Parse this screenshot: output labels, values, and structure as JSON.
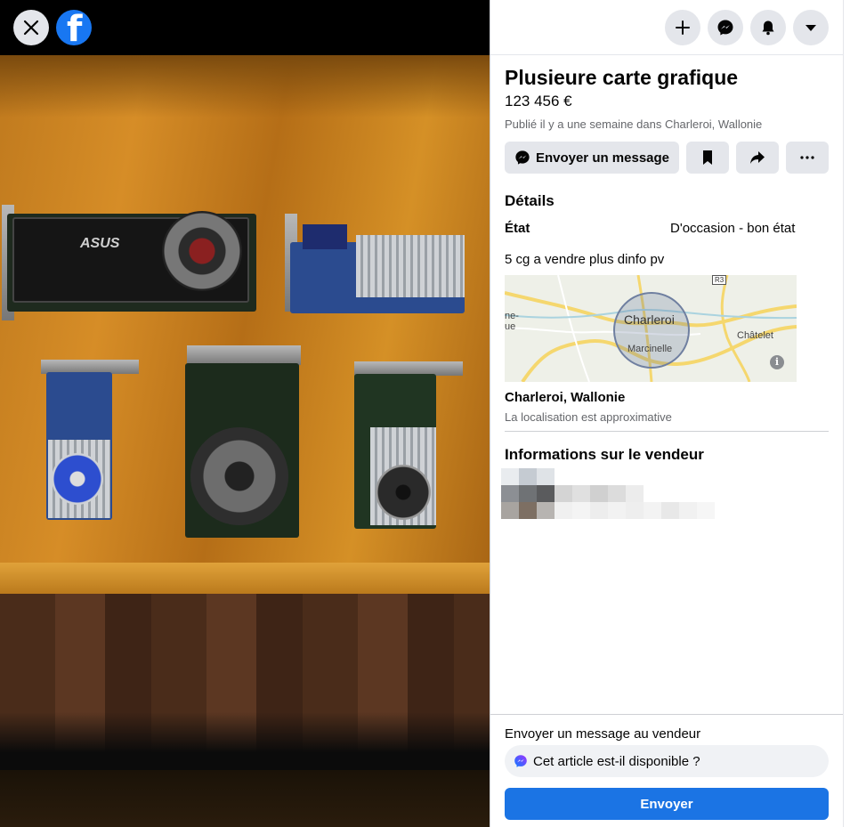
{
  "viewer": {
    "close_icon": "close-icon",
    "logo_icon": "facebook-logo-icon",
    "logo_letter": "f",
    "photo_description_icon": "listing-photo"
  },
  "header": {
    "buttons": [
      {
        "icon": "plus-icon"
      },
      {
        "icon": "messenger-icon"
      },
      {
        "icon": "bell-icon"
      },
      {
        "icon": "caret-down-icon"
      }
    ]
  },
  "listing": {
    "title": "Plusieure carte grafique",
    "price": "123 456 €",
    "posted": "Publié il y a une semaine dans Charleroi, Wallonie",
    "actions": {
      "message_label": "Envoyer un message",
      "save_icon": "bookmark-icon",
      "share_icon": "share-icon",
      "more_icon": "more-icon"
    },
    "details_heading": "Détails",
    "condition_label": "État",
    "condition_value": "D'occasion - bon état",
    "description": "5 cg a vendre plus dinfo pv",
    "map": {
      "city": "Charleroi",
      "labels": [
        "Marcinelle",
        "Châtelet",
        "ne-",
        "ue",
        "R3"
      ],
      "info_glyph": "i"
    },
    "location_name": "Charleroi, Wallonie",
    "location_note": "La localisation est approximative",
    "seller_heading": "Informations sur le vendeur"
  },
  "footer": {
    "label": "Envoyer un message au vendeur",
    "input_value": "Cet article est-il disponible ?",
    "send_label": "Envoyer"
  },
  "colors": {
    "accent": "#1b74e4",
    "facebook_blue": "#1877f2",
    "secondary_text": "#65676b",
    "button_gray": "#e4e6eb"
  }
}
